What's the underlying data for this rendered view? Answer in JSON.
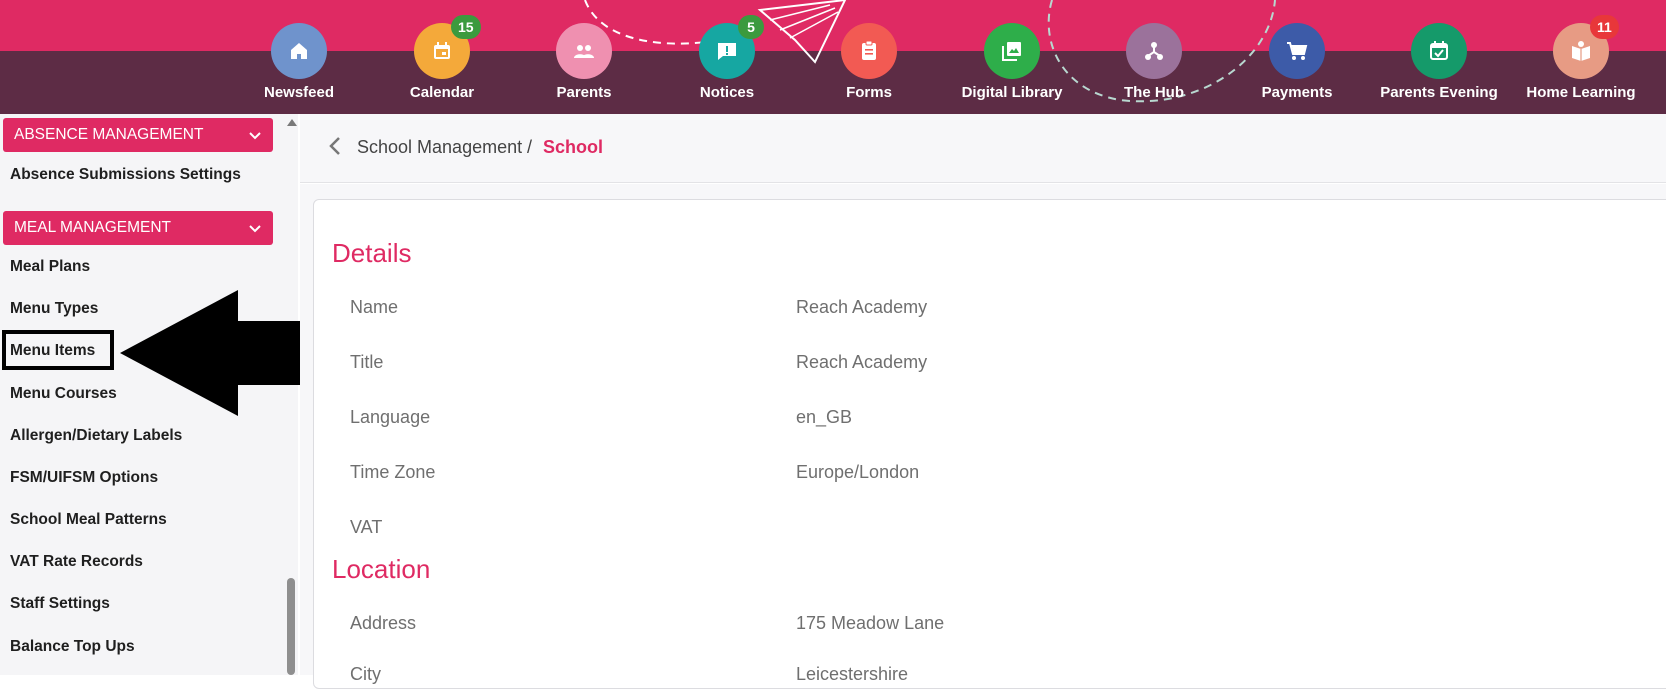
{
  "nav": {
    "items": [
      {
        "label": "Newsfeed",
        "color": "#6f93cc",
        "icon": "home-icon",
        "badge": null
      },
      {
        "label": "Calendar",
        "color": "#f4a93a",
        "icon": "calendar-icon",
        "badge": "15",
        "badge_color": "#3b9a3e"
      },
      {
        "label": "Parents",
        "color": "#ef90b0",
        "icon": "people-icon",
        "badge": null
      },
      {
        "label": "Notices",
        "color": "#16a7a2",
        "icon": "notice-icon",
        "badge": "5",
        "badge_color": "#3b9a3e"
      },
      {
        "label": "Forms",
        "color": "#f25a53",
        "icon": "clipboard-icon",
        "badge": null
      },
      {
        "label": "Digital Library",
        "color": "#2eae4a",
        "icon": "photo-library-icon",
        "badge": null
      },
      {
        "label": "The Hub",
        "color": "#9b729b",
        "icon": "hub-icon",
        "badge": null
      },
      {
        "label": "Payments",
        "color": "#3d5ba8",
        "icon": "cart-icon",
        "badge": null
      },
      {
        "label": "Parents Evening",
        "color": "#159a6a",
        "icon": "event-check-icon",
        "badge": null
      },
      {
        "label": "Home Learning",
        "color": "#e79b84",
        "icon": "book-icon",
        "badge": "11",
        "badge_color": "#e8373a"
      }
    ]
  },
  "sidebar": {
    "absence_header": "ABSENCE MANAGEMENT",
    "absence_items": [
      "Absence Submissions Settings"
    ],
    "meal_header": "MEAL MANAGEMENT",
    "meal_items": [
      "Meal Plans",
      "Menu Types",
      "Menu Items",
      "Menu Courses",
      "Allergen/Dietary Labels",
      "FSM/UIFSM Options",
      "School Meal Patterns",
      "VAT Rate Records",
      "Staff Settings",
      "Balance Top Ups"
    ]
  },
  "breadcrumb": {
    "parent": "School Management",
    "separator": "/",
    "current": "School"
  },
  "details": {
    "title": "Details",
    "fields": [
      {
        "label": "Name",
        "value": "Reach Academy"
      },
      {
        "label": "Title",
        "value": "Reach Academy"
      },
      {
        "label": "Language",
        "value": "en_GB"
      },
      {
        "label": "Time Zone",
        "value": "Europe/London"
      },
      {
        "label": "VAT",
        "value": ""
      }
    ]
  },
  "location": {
    "title": "Location",
    "fields": [
      {
        "label": "Address",
        "value": "175 Meadow Lane"
      },
      {
        "label": "City",
        "value": "Leicestershire"
      }
    ]
  },
  "colors": {
    "brand_pink": "#df2a63",
    "nav_maroon": "#5d2c45"
  }
}
